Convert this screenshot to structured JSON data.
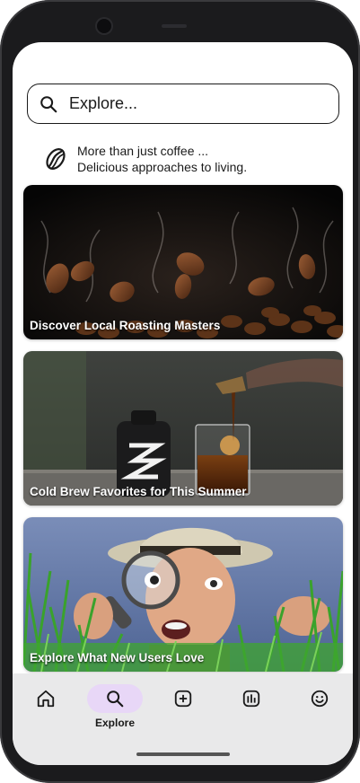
{
  "search": {
    "placeholder": "Explore..."
  },
  "tagline": {
    "line1": "More than just coffee ...",
    "line2": "Delicious approaches to living."
  },
  "cards": [
    {
      "title": "Discover Local Roasting Masters"
    },
    {
      "title": "Cold Brew Favorites for This Summer"
    },
    {
      "title": "Explore What New Users Love"
    }
  ],
  "nav": {
    "items": [
      {
        "icon": "home-icon",
        "label": ""
      },
      {
        "icon": "search-icon",
        "label": "Explore",
        "active": true
      },
      {
        "icon": "add-icon",
        "label": ""
      },
      {
        "icon": "stats-icon",
        "label": ""
      },
      {
        "icon": "smiley-icon",
        "label": ""
      }
    ]
  },
  "colors": {
    "nav_background": "#e9e9ea",
    "active_pill": "#e8d7f7",
    "text": "#1a1a1a"
  }
}
